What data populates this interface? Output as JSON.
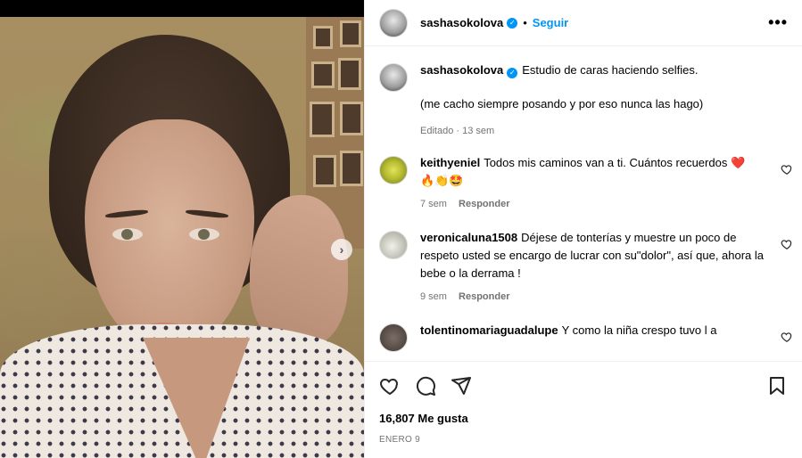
{
  "post": {
    "author": "sashasokolova",
    "follow_label": "Seguir",
    "separator": "•",
    "more_label": "•••",
    "caption_line1": "Estudio de caras haciendo selfies.",
    "caption_line2": "(me cacho siempre posando y por eso nunca las hago)",
    "caption_meta": "Editado · 13 sem",
    "likes": "16,807 Me gusta",
    "date": "ENERO 9"
  },
  "media": {
    "next_label": "›"
  },
  "comments": [
    {
      "user": "keithyeniel",
      "text": "Todos mis caminos van a ti. Cuántos recuerdos ❤️",
      "text2": "🔥👏🤩",
      "time": "7 sem",
      "reply_label": "Responder"
    },
    {
      "user": "veronicaluna1508",
      "text": "Déjese de tonterías y muestre un poco de respeto usted se encargo de lucrar con su\"dolor\", así que, ahora la bebe o la derrama !",
      "time": "9 sem",
      "reply_label": "Responder"
    },
    {
      "user": "tolentinomariaguadalupe",
      "text": "Y como la niña crespo tuvo l a"
    }
  ],
  "icons": {
    "verified": "verified-badge",
    "like": "heart-icon",
    "comment": "comment-icon",
    "share": "share-icon",
    "save": "bookmark-icon"
  },
  "colors": {
    "accent": "#0095f6",
    "muted": "#737373",
    "heart_emoji": "#ed4956"
  }
}
